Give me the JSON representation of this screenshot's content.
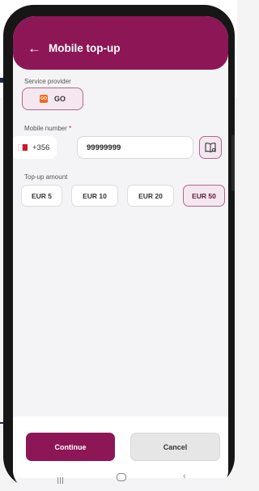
{
  "header": {
    "title": "Mobile top-up",
    "back_icon": "arrow-left-icon"
  },
  "service_provider": {
    "label": "Service provider",
    "selected": "GO",
    "logo_text": "GO"
  },
  "mobile_number": {
    "label": "Mobile number",
    "required_mark": "*",
    "country_code": "+356",
    "value": "99999999",
    "contacts_icon": "contacts-book-icon"
  },
  "topup_amount": {
    "label": "Top-up amount",
    "options": [
      "EUR 5",
      "EUR 10",
      "EUR 20",
      "EUR 50"
    ],
    "selected": "EUR 50"
  },
  "actions": {
    "continue_label": "Continue",
    "cancel_label": "Cancel"
  },
  "colors": {
    "brand": "#8c1656",
    "selected_bg": "#f5e7ef",
    "selected_border": "#b0668e"
  }
}
